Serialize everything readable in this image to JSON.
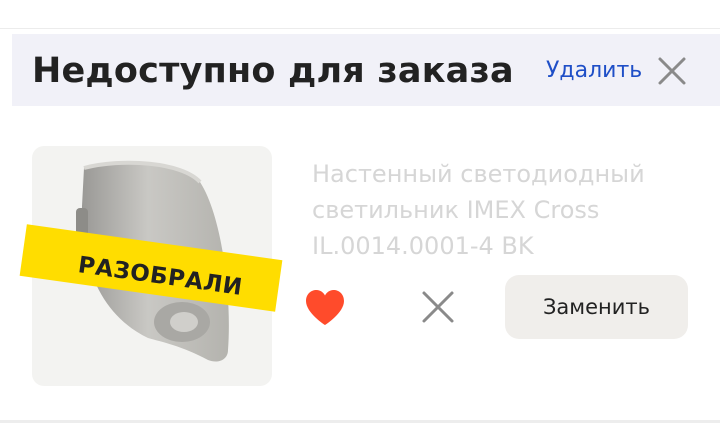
{
  "section": {
    "title": "Недоступно для заказа",
    "delete_label": "Удалить",
    "close_icon": "close-icon"
  },
  "item": {
    "badge": "РАЗОБРАЛИ",
    "name": "Настенный светодиодный светильник IMEX Cross IL.0014.0001-4 BK",
    "favorite_icon": "heart-icon",
    "favorite_color": "#ff4b2b",
    "remove_icon": "close-icon",
    "replace_label": "Заменить"
  },
  "colors": {
    "link": "#1f4fc7",
    "badge_bg": "#ffdd00",
    "header_bg": "#f1f1f8",
    "muted_text": "#d6d6d6"
  }
}
